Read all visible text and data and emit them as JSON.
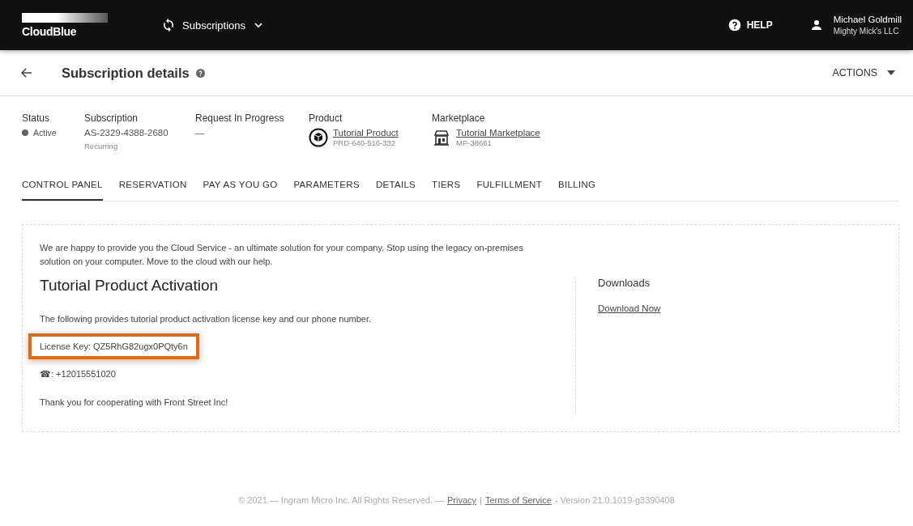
{
  "top_bar": {
    "logo": "CloudBlue",
    "module": "Subscriptions",
    "help": "HELP",
    "user": {
      "name": "Michael Goldmill",
      "company": "Mighty Mick's LLC"
    }
  },
  "header": {
    "title": "Subscription details",
    "actions": "ACTIONS"
  },
  "info": {
    "status": {
      "label": "Status",
      "value": "Active",
      "color": "#616161"
    },
    "subscription": {
      "label": "Subscription",
      "value": "AS-2329-4388-2680",
      "sub": "Recurring"
    },
    "request": {
      "label": "Request In Progress",
      "value": "—"
    },
    "product": {
      "label": "Product",
      "name": "Tutorial Product",
      "id": "PRD-640-516-332"
    },
    "marketplace": {
      "label": "Marketplace",
      "name": "Tutorial Marketplace",
      "id": "MP-38661"
    }
  },
  "tabs": [
    {
      "label": "CONTROL PANEL",
      "selected": true
    },
    {
      "label": "RESERVATION",
      "selected": false
    },
    {
      "label": "PAY AS YOU GO",
      "selected": false
    },
    {
      "label": "PARAMETERS",
      "selected": false
    },
    {
      "label": "DETAILS",
      "selected": false
    },
    {
      "label": "TIERS",
      "selected": false
    },
    {
      "label": "FULFILLMENT",
      "selected": false
    },
    {
      "label": "BILLING",
      "selected": false
    }
  ],
  "panel": {
    "intro": "We are happy to provide you the Cloud Service - an ultimate solution for your company. Stop using the legacy on-premises solution on your computer. Move to the cloud with our help.",
    "heading": "Tutorial Product Activation",
    "lines": [
      {
        "kind": "text",
        "text": "The following provides tutorial product activation license key and our phone number.",
        "highlighted": false
      },
      {
        "kind": "text",
        "text": "License Key: QZ5RhG82ugx0PQty6n",
        "highlighted": true
      },
      {
        "kind": "phone",
        "icon": "☎",
        "text": ": +12015551020",
        "highlighted": false
      },
      {
        "kind": "text",
        "text": "Thank you for cooperating with Front Street Inc!",
        "highlighted": false
      }
    ],
    "downloads": {
      "heading": "Downloads",
      "link": "Download Now"
    }
  },
  "footer": {
    "copyright": "© 2021 — Ingram Micro Inc. All Rights Reserved. —",
    "privacy": "Privacy",
    "separator": "|",
    "terms": "Terms of Service",
    "version": "- Version 21.0.1019-g3390408"
  }
}
